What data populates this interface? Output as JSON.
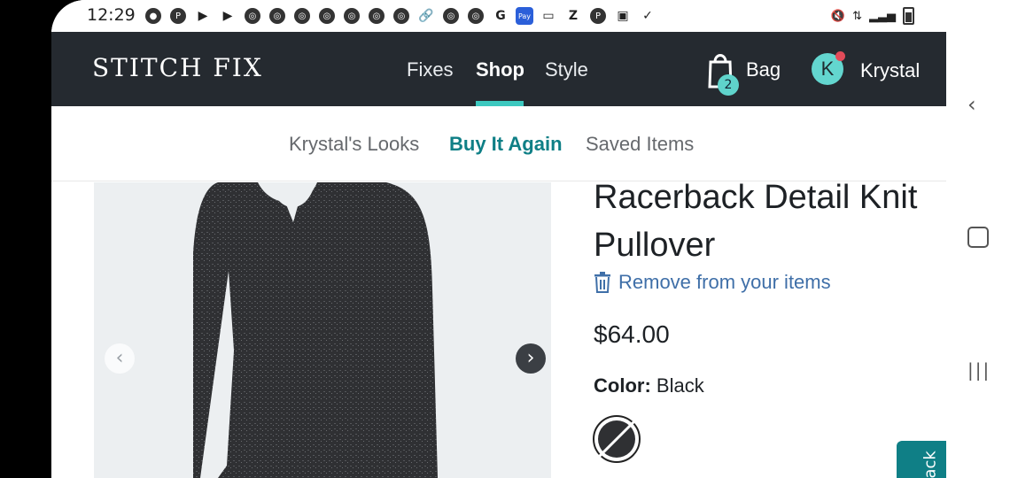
{
  "status": {
    "time": "12:29",
    "icons": [
      "messenger-icon",
      "pinterest-icon",
      "youtube-icon",
      "youtube-icon",
      "chrome-icon",
      "chrome-icon",
      "chrome-icon",
      "chrome-icon",
      "chrome-icon",
      "chrome-icon",
      "chrome-icon",
      "link-icon",
      "chrome-icon",
      "chrome-icon",
      "google-icon",
      "pay-icon",
      "amazon-icon",
      "z-icon",
      "pinterest-icon",
      "bag-icon",
      "cart-icon"
    ],
    "pay_label": "Pay"
  },
  "nav": {
    "brand": "STITCH FIX",
    "links": [
      "Fixes",
      "Shop",
      "Style"
    ],
    "active": "Shop",
    "bag_count": "2",
    "bag_label": "Bag",
    "avatar_initial": "K",
    "user_name": "Krystal"
  },
  "subnav": {
    "links": [
      "Krystal's Looks",
      "Buy It Again",
      "Saved Items"
    ],
    "active": "Buy It Again"
  },
  "product": {
    "title": "Racerback Detail Knit Pullover",
    "remove_label": "Remove from your items",
    "price": "$64.00",
    "color_label": "Color:",
    "color_value": "Black"
  },
  "feedback": {
    "label": "ack"
  },
  "colors": {
    "nav_bg": "#252a30",
    "accent": "#3cc8bf",
    "teal": "#0f7f86",
    "link_blue": "#3f6fa8"
  }
}
